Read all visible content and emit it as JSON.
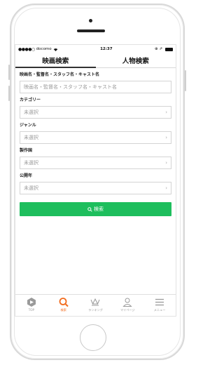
{
  "status_bar": {
    "signal_dots": "●●●●○",
    "carrier": "docomo",
    "wifi_icon": "wifi-icon",
    "time": "12:37",
    "right_icons": "⊕ ⇗",
    "battery_icon": "battery-icon"
  },
  "tabs": [
    {
      "label": "映画検索",
      "active": true
    },
    {
      "label": "人物検索",
      "active": false
    }
  ],
  "form": {
    "keyword": {
      "label": "映画名・監督名・スタッフ名・キャスト名",
      "placeholder": "映画名・監督名・スタッフ名・キャスト名"
    },
    "category": {
      "label": "カテゴリー",
      "value": "未選択"
    },
    "genre": {
      "label": "ジャンル",
      "value": "未選択"
    },
    "country": {
      "label": "製作国",
      "value": "未選択"
    },
    "release_year": {
      "label": "公開年",
      "value": "未選択"
    },
    "chevron": "›",
    "search_button": {
      "label": "検索",
      "icon": "search-icon"
    }
  },
  "tab_bar": [
    {
      "label": "TOP",
      "icon": "top-icon",
      "active": false
    },
    {
      "label": "検索",
      "icon": "search-icon",
      "active": true
    },
    {
      "label": "ランキング",
      "icon": "crown-icon",
      "active": false
    },
    {
      "label": "マイページ",
      "icon": "user-icon",
      "active": false
    },
    {
      "label": "メニュー",
      "icon": "menu-icon",
      "active": false
    }
  ],
  "colors": {
    "accent_green": "#1ebe5d",
    "active_orange": "#f26b1d",
    "inactive_gray": "#9a9a9a"
  }
}
